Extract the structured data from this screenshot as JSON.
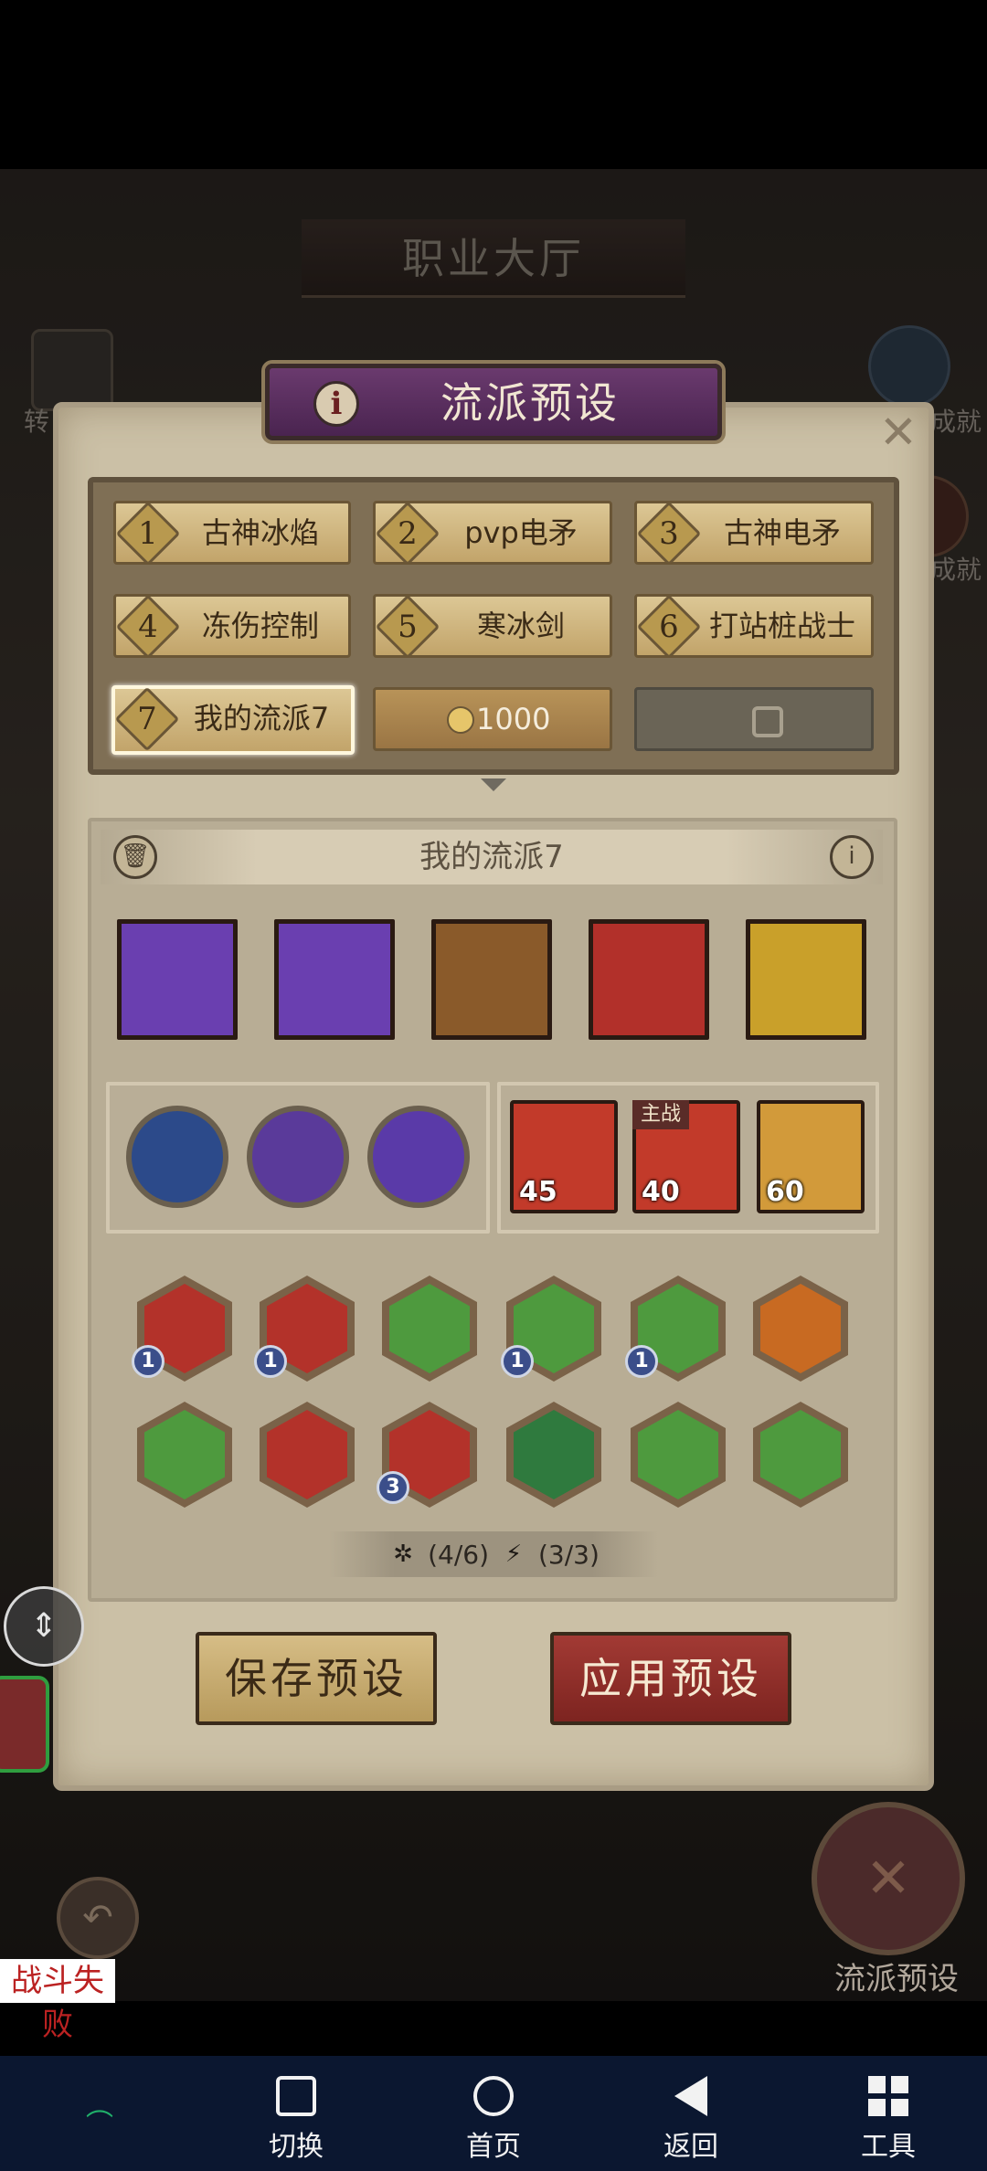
{
  "game": {
    "hall_title": "职业大厅",
    "left_side_label": "转",
    "right_side_labels": [
      "成就",
      "成就"
    ]
  },
  "dialog": {
    "title": "流派预设",
    "close_icon": "close-icon",
    "info_icon": "info-icon",
    "slots": [
      {
        "num": "1",
        "label": "古神冰焰"
      },
      {
        "num": "2",
        "label": "pvp电矛"
      },
      {
        "num": "3",
        "label": "古神电矛"
      },
      {
        "num": "4",
        "label": "冻伤控制"
      },
      {
        "num": "5",
        "label": "寒冰剑"
      },
      {
        "num": "6",
        "label": "打站桩战士"
      },
      {
        "num": "7",
        "label": "我的流派7",
        "selected": true
      }
    ],
    "unlock_cost": "1000",
    "build_name": "我的流派7",
    "skills": [
      {
        "name": "lightning-skill-icon",
        "color": "#6a3fb0"
      },
      {
        "name": "lightning-fist-skill-icon",
        "color": "#6a3fb0"
      },
      {
        "name": "slash-skill-icon",
        "color": "#8a5a2a"
      },
      {
        "name": "beast-skill-icon",
        "color": "#b2302a"
      },
      {
        "name": "golden-figure-skill-icon",
        "color": "#c9a02a"
      }
    ],
    "orbs": [
      {
        "name": "water-orb-icon",
        "color": "#2c4a8a"
      },
      {
        "name": "hooded-figure-orb-icon",
        "color": "#5a3a9a"
      },
      {
        "name": "purple-fist-orb-icon",
        "color": "#5a3aa8"
      }
    ],
    "cards": [
      {
        "name": "knight-card",
        "stat": "45",
        "color": "#c23a2a",
        "tag": ""
      },
      {
        "name": "dog-card",
        "stat": "40",
        "color": "#c23a2a",
        "tag": "主战"
      },
      {
        "name": "skull-card",
        "stat": "60",
        "color": "#d29a3a",
        "tag": ""
      }
    ],
    "equipment_row1": [
      {
        "name": "red-rune-equip",
        "color": "#b3322a",
        "level": "1"
      },
      {
        "name": "ice-claw-equip",
        "color": "#b3322a",
        "level": "1"
      },
      {
        "name": "raven-helm-equip",
        "color": "#4e9a3e",
        "level": ""
      },
      {
        "name": "dark-robe-equip",
        "color": "#4e9a3e",
        "level": "1"
      },
      {
        "name": "hooded-mask-equip",
        "color": "#4e9a3e",
        "level": "1"
      },
      {
        "name": "pants-equip",
        "color": "#c86a22",
        "level": ""
      }
    ],
    "equipment_row2": [
      {
        "name": "dark-armor-equip",
        "color": "#4e9a3e",
        "level": ""
      },
      {
        "name": "red-helm-equip",
        "color": "#b3322a",
        "level": ""
      },
      {
        "name": "serpent-ring-equip",
        "color": "#b3322a",
        "level": "3"
      },
      {
        "name": "gold-necklace-equip",
        "color": "#2f7a3e",
        "level": ""
      },
      {
        "name": "altar-equip",
        "color": "#4e9a3e",
        "level": ""
      },
      {
        "name": "gold-cube-equip",
        "color": "#4e9a3e",
        "level": ""
      }
    ],
    "set_bonus": {
      "spider_count": "(4/6)",
      "bolt_count": "(3/3)"
    },
    "save_label": "保存预设",
    "apply_label": "应用预设"
  },
  "overlay": {
    "preset_emblem_label": "流派预设",
    "battle_fail": "战斗失败"
  },
  "navbar": {
    "items": [
      {
        "label": "切换",
        "icon": "square-icon"
      },
      {
        "label": "首页",
        "icon": "circle-icon"
      },
      {
        "label": "返回",
        "icon": "triangle-back-icon"
      },
      {
        "label": "工具",
        "icon": "grid-icon"
      }
    ]
  }
}
